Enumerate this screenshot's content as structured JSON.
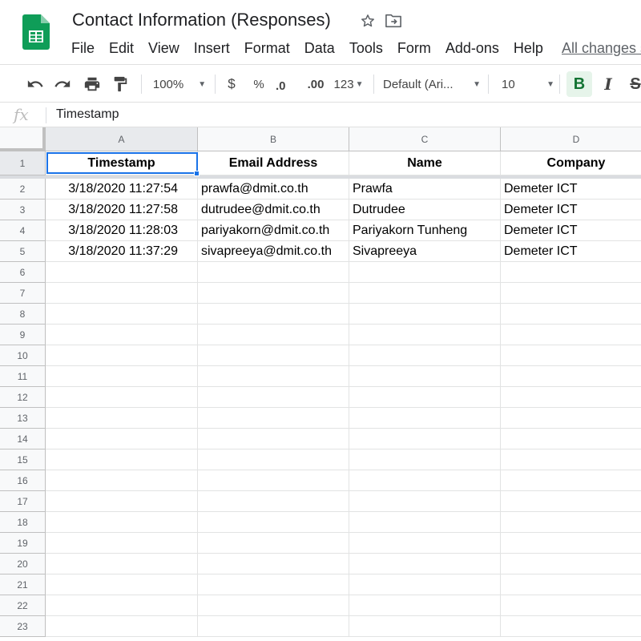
{
  "app": {
    "doc_title": "Contact Information (Responses)",
    "menu": [
      "File",
      "Edit",
      "View",
      "Insert",
      "Format",
      "Data",
      "Tools",
      "Form",
      "Add-ons",
      "Help"
    ],
    "save_status": "All changes s"
  },
  "toolbar": {
    "zoom": "100%",
    "currency": "$",
    "percent": "%",
    "decrease_decimals": ".0",
    "increase_decimals": ".00",
    "more_formats": "123",
    "font": "Default (Ari...",
    "font_size": "10",
    "bold": "B",
    "italic": "I",
    "strikethrough": "S"
  },
  "formula_bar": {
    "fx": "fx",
    "value": "Timestamp"
  },
  "sheet": {
    "columns": [
      "A",
      "B",
      "C",
      "D"
    ],
    "row_numbers": [
      "1",
      "2",
      "3",
      "4",
      "5",
      "6",
      "7",
      "8",
      "9",
      "10",
      "11",
      "12",
      "13",
      "14",
      "15",
      "16",
      "17",
      "18",
      "19",
      "20",
      "21",
      "22",
      "23"
    ],
    "header_row": [
      "Timestamp",
      "Email Address",
      "Name",
      "Company"
    ],
    "rows": [
      [
        "3/18/2020 11:27:54",
        "prawfa@dmit.co.th",
        "Prawfa",
        "Demeter ICT"
      ],
      [
        "3/18/2020 11:27:58",
        "dutrudee@dmit.co.th",
        "Dutrudee",
        "Demeter ICT"
      ],
      [
        "3/18/2020 11:28:03",
        "pariyakorn@dmit.co.th",
        "Pariyakorn Tunheng",
        "Demeter ICT"
      ],
      [
        "3/18/2020 11:37:29",
        "sivapreeya@dmit.co.th",
        "Sivapreeya",
        "Demeter ICT"
      ]
    ],
    "selected_cell": "A1"
  }
}
